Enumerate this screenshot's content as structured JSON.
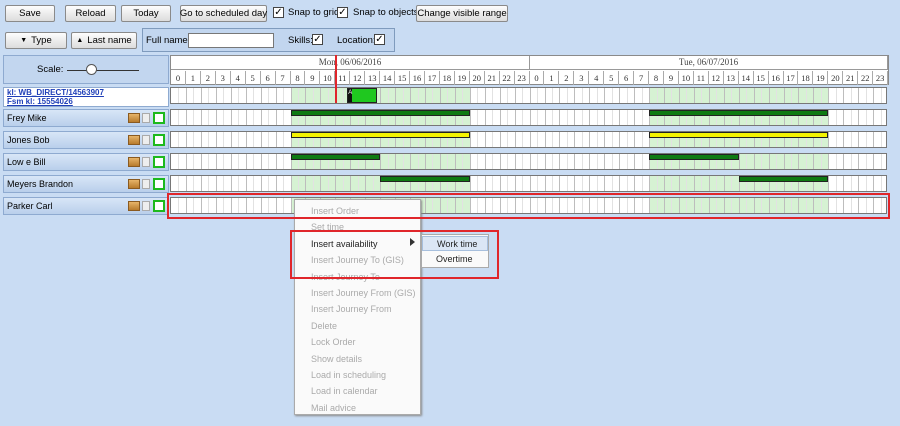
{
  "toolbar": {
    "save": "Save",
    "reload": "Reload",
    "today": "Today",
    "goto": "Go to scheduled day",
    "snap_grid": "Snap to grid",
    "snap_objects": "Snap to objects",
    "change_range": "Change visible range",
    "check": "✓"
  },
  "filters": {
    "type": "Type",
    "last_name": "Last name",
    "full_name_label": "Full name:",
    "full_name_value": "",
    "skills": "Skills:",
    "location": "Location:"
  },
  "scale": {
    "label": "Scale:"
  },
  "days": [
    {
      "label": "Mon, 06/06/2016"
    },
    {
      "label": "Tue, 06/07/2016"
    }
  ],
  "hours": [
    "0",
    "1",
    "2",
    "3",
    "4",
    "5",
    "6",
    "7",
    "8",
    "9",
    "10",
    "11",
    "12",
    "13",
    "14",
    "15",
    "16",
    "17",
    "18",
    "19",
    "20",
    "21",
    "22",
    "23"
  ],
  "order": {
    "line1": "kl: WB_DIRECT/14563907",
    "line2": "Fsm kl: 15554026",
    "marker": "A"
  },
  "technicians": [
    {
      "name": "Frey Mike"
    },
    {
      "name": "Jones Bob"
    },
    {
      "name": "Low e Bill"
    },
    {
      "name": "Meyers Brandon"
    },
    {
      "name": "Parker Carl"
    }
  ],
  "context_menu": [
    {
      "label": "Insert Order",
      "enabled": false
    },
    {
      "label": "Set time",
      "enabled": false
    },
    {
      "label": "Insert availability",
      "enabled": true
    },
    {
      "label": "Insert Journey To (GIS)",
      "enabled": false
    },
    {
      "label": "Insert Journey To",
      "enabled": false
    },
    {
      "label": "Insert Journey From (GIS)",
      "enabled": false
    },
    {
      "label": "Insert Journey From",
      "enabled": false
    },
    {
      "label": "Delete",
      "enabled": false
    },
    {
      "label": "Lock Order",
      "enabled": false
    },
    {
      "label": "Show details",
      "enabled": false
    },
    {
      "label": "Load in scheduling",
      "enabled": false
    },
    {
      "label": "Load in calendar",
      "enabled": false
    },
    {
      "label": "Mail advice",
      "enabled": false
    }
  ],
  "submenu": [
    {
      "label": "Work time"
    },
    {
      "label": "Overtime"
    }
  ],
  "colors": {
    "work_hours": "#d6f2d3",
    "order_bar": "#1fc81f",
    "shift_bar": "#0e7a12",
    "pending_bar": "#f4f400",
    "highlight": "#e0262b"
  }
}
